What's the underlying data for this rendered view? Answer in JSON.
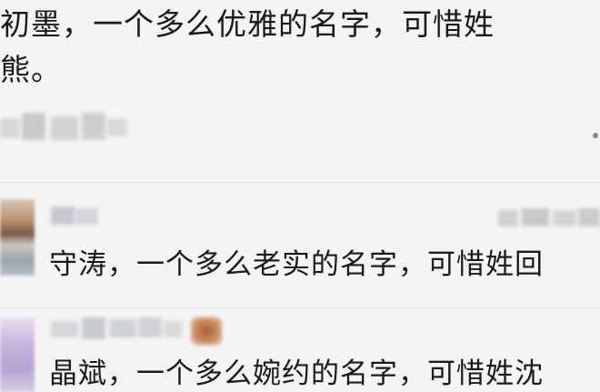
{
  "post": {
    "text": "初墨，一个多么优雅的名字，可惜姓\n熊。"
  },
  "comments": [
    {
      "text": "守涛，一个多么老实的名字，可惜姓回"
    },
    {
      "text": "晶斌，一个多么婉约的名字，可惜姓沈"
    }
  ],
  "colors": {
    "background": "#f4f4f5",
    "text": "#1a1a1a",
    "divider": "#e3e3e5"
  },
  "icons": {
    "more": "more-dots-icon"
  }
}
